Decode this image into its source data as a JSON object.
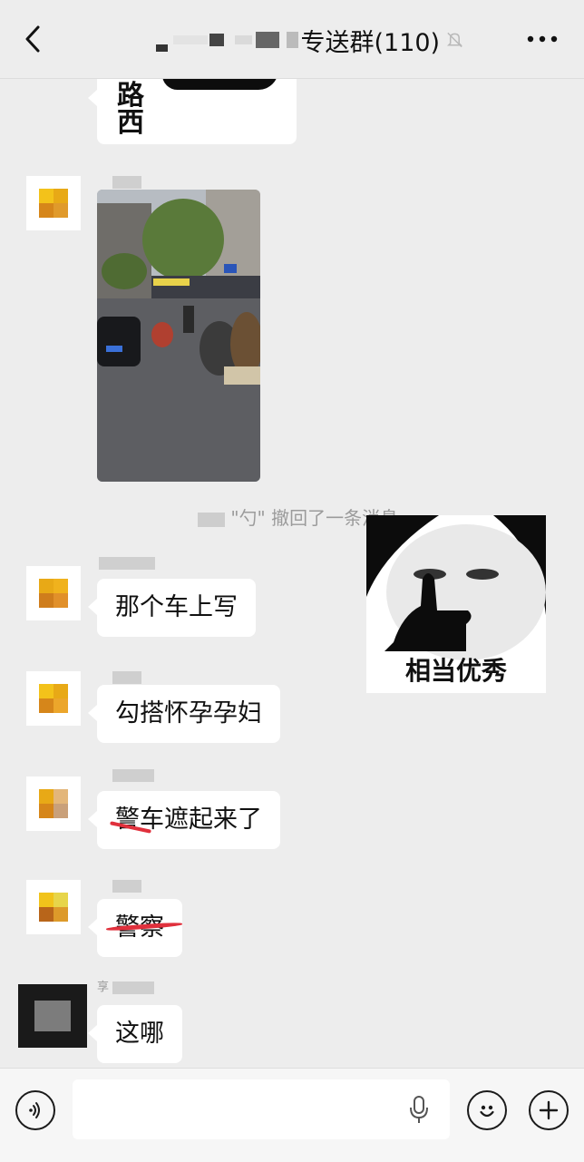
{
  "header": {
    "title": "专送群(110)",
    "back_icon": "chevron-left-icon",
    "mute_icon": "bell-off-icon",
    "more_icon": "more-dots-icon"
  },
  "messages": {
    "top_bubble_text": "路西",
    "recall_notice": "\"勺\" 撤回了一条消息",
    "sticker_caption": "相当优秀",
    "m1": "那个车上写",
    "m2": "勾搭怀孕孕妇",
    "m3": "警车遮起来了",
    "m4": "警察",
    "m5": "这哪",
    "m5_nick_prefix": "享"
  },
  "input_bar": {
    "placeholder": "",
    "voice_icon": "voice-toggle-icon",
    "mic_icon": "microphone-icon",
    "emoji_icon": "emoji-icon",
    "plus_icon": "plus-icon"
  },
  "colors": {
    "background": "#ededed",
    "bubble": "#ffffff",
    "strike": "#e0303c",
    "recall_text": "#9b9b9b"
  }
}
